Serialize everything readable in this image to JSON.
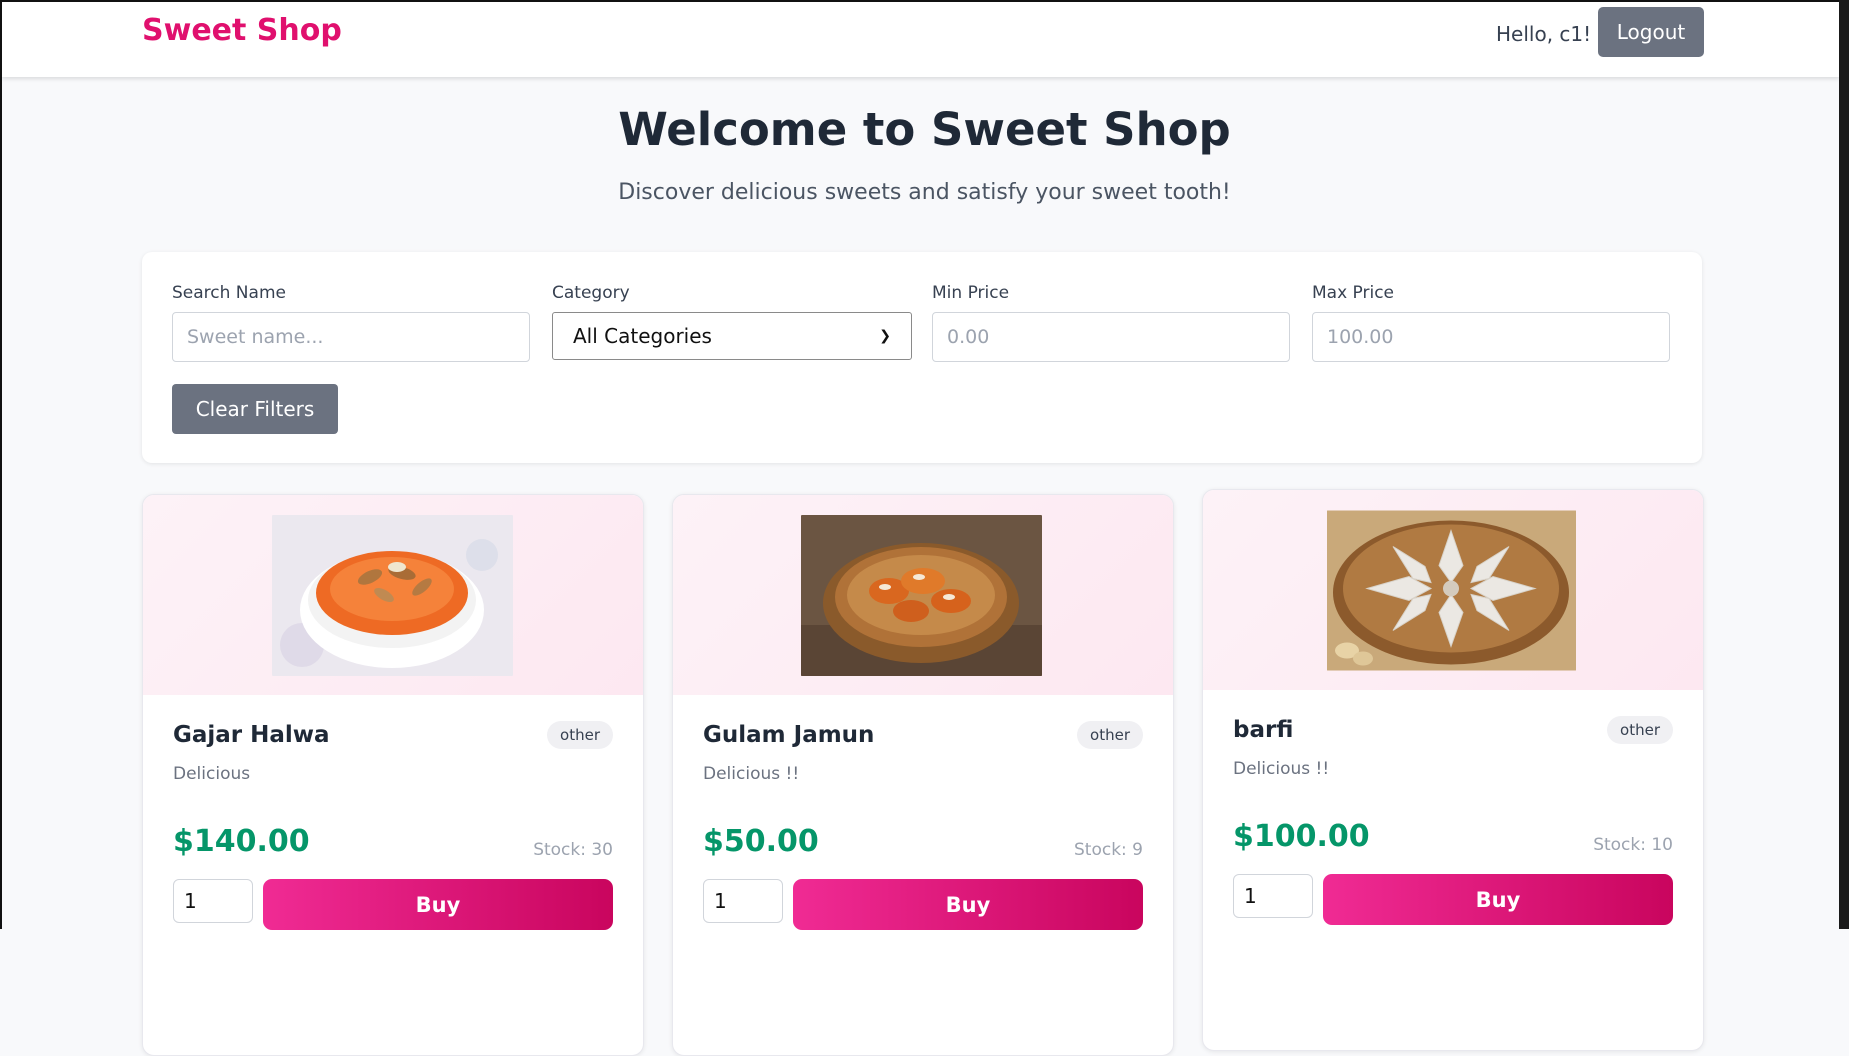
{
  "nav": {
    "brand": "Sweet Shop",
    "greeting": "Hello, c1!",
    "logout_label": "Logout"
  },
  "hero": {
    "title": "Welcome to Sweet Shop",
    "subtitle": "Discover delicious sweets and satisfy your sweet tooth!"
  },
  "filters": {
    "search_label": "Search Name",
    "search_placeholder": "Sweet name...",
    "category_label": "Category",
    "category_selected": "All Categories",
    "min_label": "Min Price",
    "min_placeholder": "0.00",
    "max_label": "Max Price",
    "max_placeholder": "100.00",
    "clear_label": "Clear Filters"
  },
  "sweets": [
    {
      "name": "Gajar Halwa",
      "category": "other",
      "description": "Delicious",
      "price": "$140.00",
      "stock": "Stock: 30",
      "qty": "1",
      "buy_label": "Buy",
      "image": "gajar-halwa-image"
    },
    {
      "name": "Gulam Jamun",
      "category": "other",
      "description": "Delicious !!",
      "price": "$50.00",
      "stock": "Stock: 9",
      "qty": "1",
      "buy_label": "Buy",
      "image": "gulab-jamun-image"
    },
    {
      "name": "barfi",
      "category": "other",
      "description": "Delicious !!",
      "price": "$100.00",
      "stock": "Stock: 10",
      "qty": "1",
      "buy_label": "Buy",
      "image": "kaju-barfi-image"
    }
  ],
  "colors": {
    "brand": "#e0106e",
    "price": "#059669",
    "buy_gradient_start": "#f02b94",
    "buy_gradient_end": "#c9055e",
    "secondary_button": "#6b7280"
  }
}
